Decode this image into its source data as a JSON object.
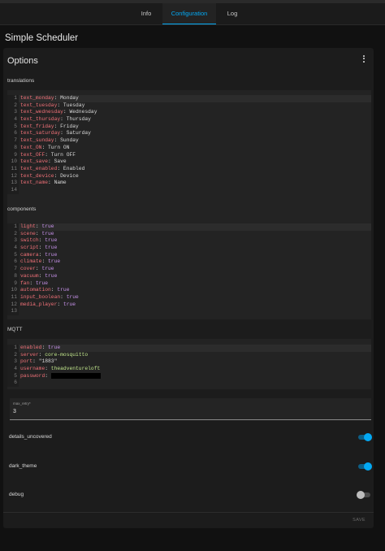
{
  "tabs": [
    {
      "label": "Info",
      "active": false
    },
    {
      "label": "Configuration",
      "active": true
    },
    {
      "label": "Log",
      "active": false
    }
  ],
  "page": {
    "title": "Simple Scheduler"
  },
  "card": {
    "title": "Options",
    "menu_icon": "dots-vertical-icon"
  },
  "sections": {
    "translations": {
      "label": "translations",
      "lines": [
        {
          "key": "text_monday",
          "value": "Monday"
        },
        {
          "key": "text_tuesday",
          "value": "Tuesday"
        },
        {
          "key": "text_wednesday",
          "value": "Wednesday"
        },
        {
          "key": "text_thursday",
          "value": "Thursday"
        },
        {
          "key": "text_friday",
          "value": "Friday"
        },
        {
          "key": "text_saturday",
          "value": "Saturday"
        },
        {
          "key": "text_sunday",
          "value": "Sunday"
        },
        {
          "key": "text_ON",
          "value": "Turn ON"
        },
        {
          "key": "text_OFF",
          "value": "Turn OFF"
        },
        {
          "key": "text_save",
          "value": "Save"
        },
        {
          "key": "text_enabled",
          "value": "Enabled"
        },
        {
          "key": "text_device",
          "value": "Device"
        },
        {
          "key": "text_name",
          "value": "Name"
        },
        {
          "key": "",
          "value": ""
        }
      ]
    },
    "components": {
      "label": "components",
      "lines": [
        {
          "key": "light",
          "value": "true"
        },
        {
          "key": "scene",
          "value": "true"
        },
        {
          "key": "switch",
          "value": "true"
        },
        {
          "key": "script",
          "value": "true"
        },
        {
          "key": "camera",
          "value": "true"
        },
        {
          "key": "climate",
          "value": "true"
        },
        {
          "key": "cover",
          "value": "true"
        },
        {
          "key": "vacuum",
          "value": "true"
        },
        {
          "key": "fan",
          "value": "true"
        },
        {
          "key": "automation",
          "value": "true"
        },
        {
          "key": "input_boolean",
          "value": "true"
        },
        {
          "key": "media_player",
          "value": "true"
        },
        {
          "key": "",
          "value": ""
        }
      ]
    },
    "mqtt": {
      "label": "MQTT",
      "lines": [
        {
          "key": "enabled",
          "value": "true"
        },
        {
          "key": "server",
          "value": "core-mosquitto"
        },
        {
          "key": "port",
          "value": "\"1883\""
        },
        {
          "key": "username",
          "value": "theadventureloft"
        },
        {
          "key": "password",
          "value": ""
        },
        {
          "key": "",
          "value": ""
        }
      ]
    }
  },
  "max_retry": {
    "label": "max_retry*",
    "value": "3"
  },
  "toggles": [
    {
      "label": "details_uncovered",
      "on": true
    },
    {
      "label": "dark_theme",
      "on": true
    },
    {
      "label": "debug",
      "on": false
    }
  ],
  "save_label": "SAVE",
  "colors": {
    "accent": "#03a9f4",
    "key": "#f07178",
    "boolean": "#c792ea",
    "string": "#c3e88d",
    "background": "#111111",
    "card": "#1c1c1c"
  }
}
